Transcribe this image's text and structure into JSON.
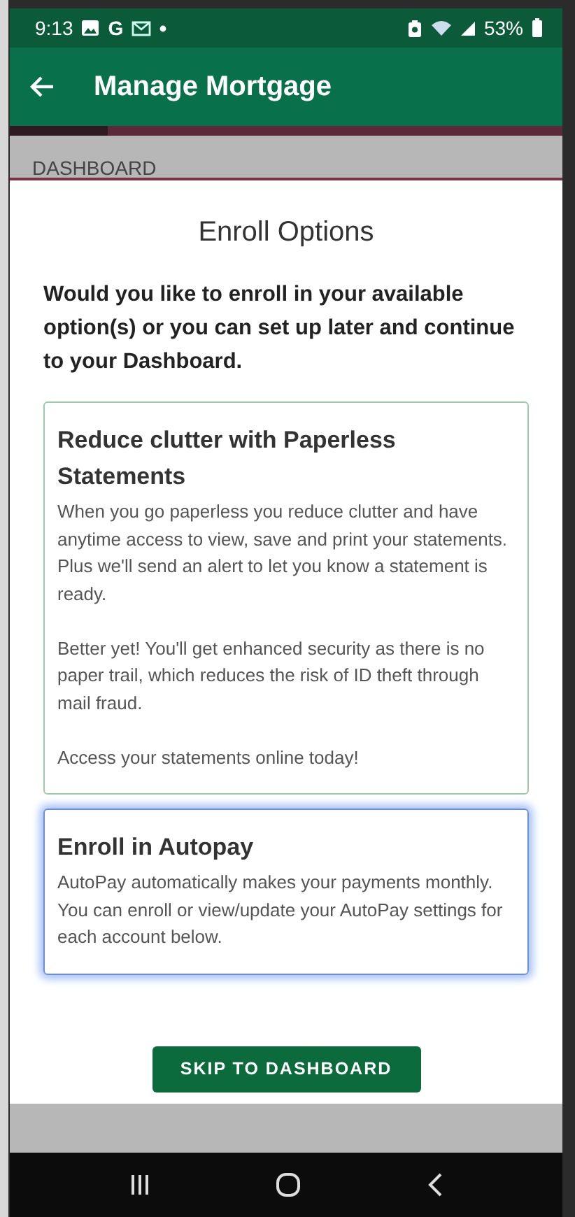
{
  "status_bar": {
    "time": "9:13",
    "notification_letter": "G",
    "battery": "53%"
  },
  "app_bar": {
    "title": "Manage Mortgage"
  },
  "background_tab": {
    "label": "DASHBOARD"
  },
  "dialog": {
    "title": "Enroll Options",
    "intro": "Would you like to enroll in your available option(s) or you can set up later and continue to your Dashboard.",
    "options": [
      {
        "title": "Reduce clutter with Paperless Statements",
        "selected": false,
        "paragraphs": [
          "When you go paperless you reduce clutter and have anytime access to view, save and print your statements. Plus we'll send an alert to let you know a statement is ready.",
          "Better yet! You'll get enhanced security as there is no paper trail, which reduces the risk of ID theft through mail fraud.",
          "Access your statements online today!"
        ]
      },
      {
        "title": "Enroll in Autopay",
        "selected": true,
        "paragraphs": [
          "AutoPay automatically makes your payments monthly. You can enroll or view/update your AutoPay settings for each account below."
        ]
      }
    ],
    "button": "SKIP TO DASHBOARD"
  }
}
